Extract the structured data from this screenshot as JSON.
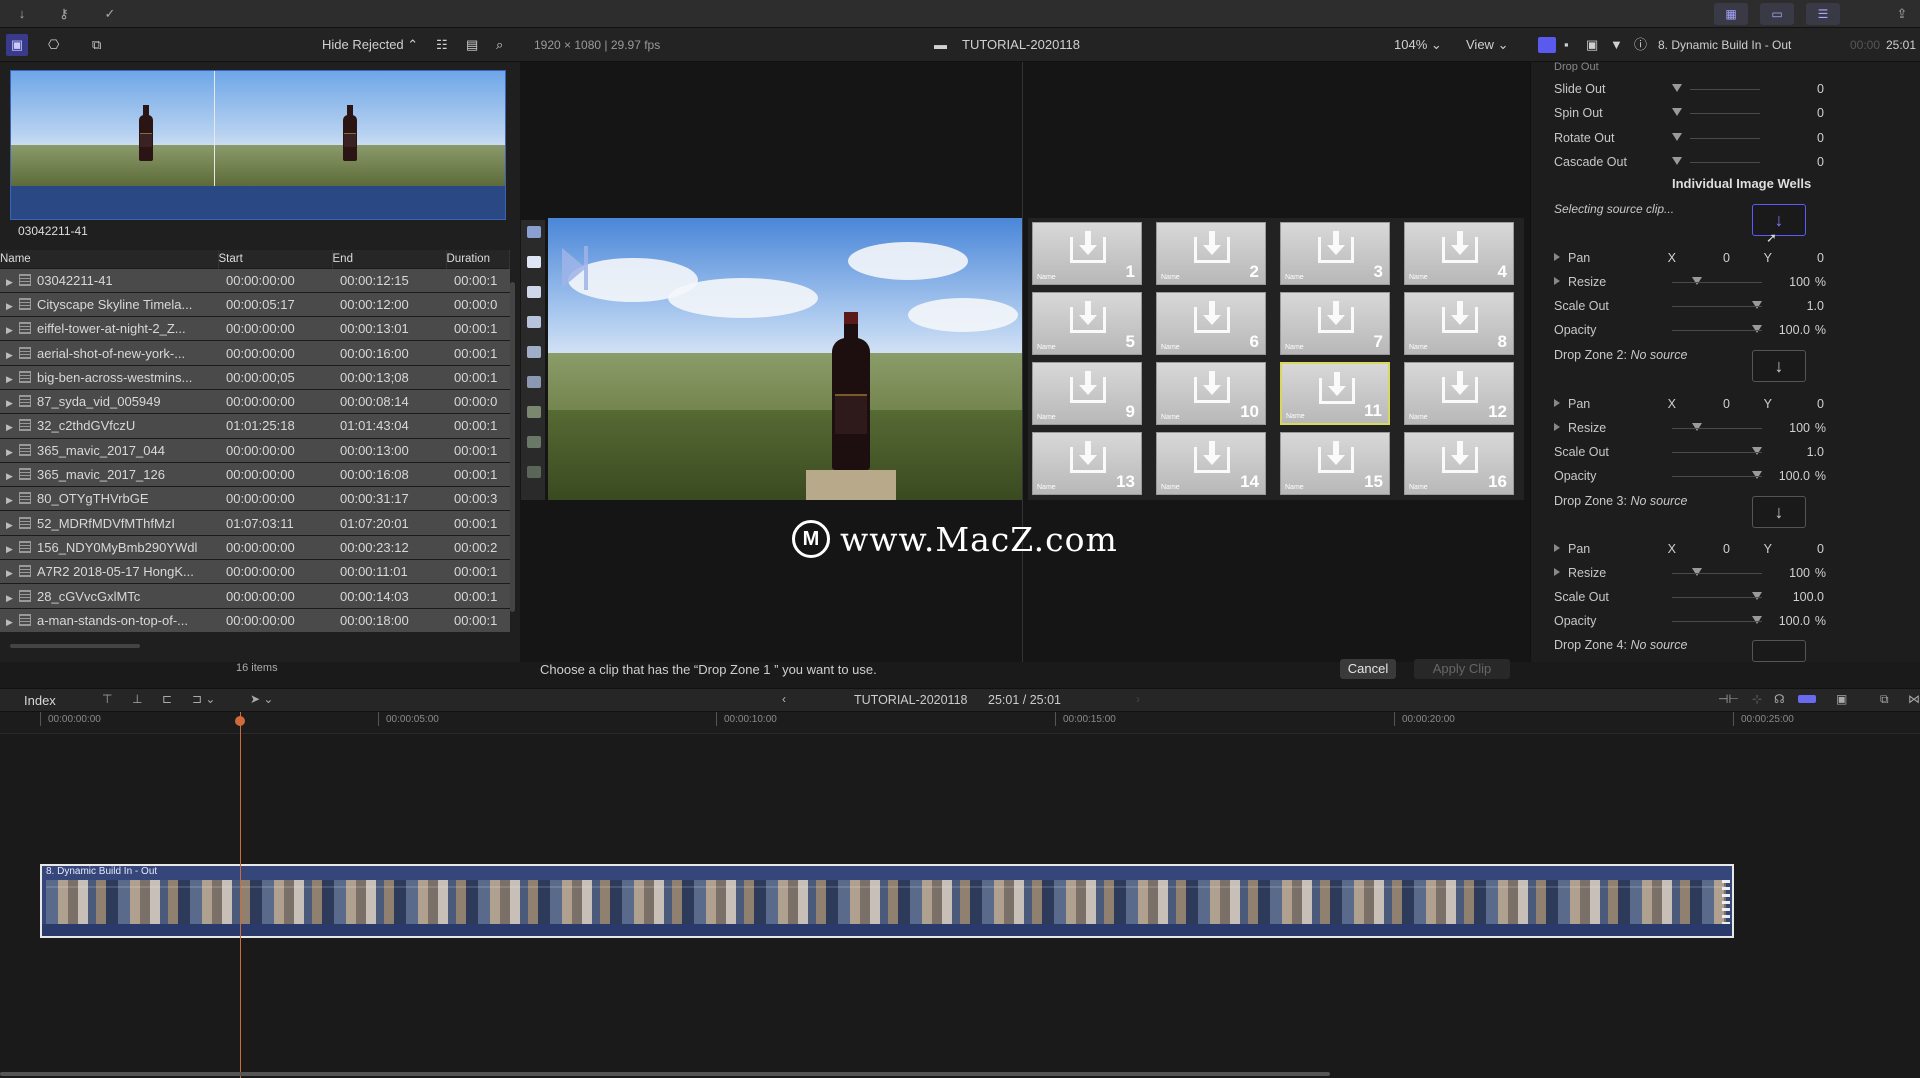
{
  "toolbar": {
    "import_icon": "download-icon",
    "keyword_icon": "key-icon",
    "check_icon": "checkmark-circle-icon"
  },
  "browser_bar": {
    "filter": "Hide Rejected",
    "format": "1920 × 1080 | 29.97 fps",
    "project_title": "TUTORIAL-2020118",
    "zoom": "104%",
    "view": "View",
    "clip_title": "8. Dynamic Build In - Out",
    "tc_dim": "00:00",
    "tc": "25:01"
  },
  "browser": {
    "thumbnail_label": "03042211-41",
    "columns": [
      "Name",
      "Start",
      "End",
      "Duration"
    ],
    "rows": [
      {
        "name": "03042211-41",
        "start": "00:00:00:00",
        "end": "00:00:12:15",
        "dur": "00:00:1"
      },
      {
        "name": "Cityscape Skyline Timela...",
        "start": "00:00:05:17",
        "end": "00:00:12:00",
        "dur": "00:00:0"
      },
      {
        "name": "eiffel-tower-at-night-2_Z...",
        "start": "00:00:00:00",
        "end": "00:00:13:01",
        "dur": "00:00:1"
      },
      {
        "name": "aerial-shot-of-new-york-...",
        "start": "00:00:00:00",
        "end": "00:00:16:00",
        "dur": "00:00:1"
      },
      {
        "name": "big-ben-across-westmins...",
        "start": "00:00:00;05",
        "end": "00:00:13;08",
        "dur": "00:00:1"
      },
      {
        "name": "87_syda_vid_005949",
        "start": "00:00:00:00",
        "end": "00:00:08:14",
        "dur": "00:00:0"
      },
      {
        "name": "32_c2thdGVfczU",
        "start": "01:01:25:18",
        "end": "01:01:43:04",
        "dur": "00:00:1"
      },
      {
        "name": "365_mavic_2017_044",
        "start": "00:00:00:00",
        "end": "00:00:13:00",
        "dur": "00:00:1"
      },
      {
        "name": "365_mavic_2017_126",
        "start": "00:00:00:00",
        "end": "00:00:16:08",
        "dur": "00:00:1"
      },
      {
        "name": "80_OTYgTHVrbGE",
        "start": "00:00:00:00",
        "end": "00:00:31:17",
        "dur": "00:00:3"
      },
      {
        "name": "52_MDRfMDVfMThfMzI",
        "start": "01:07:03:11",
        "end": "01:07:20:01",
        "dur": "00:00:1"
      },
      {
        "name": "156_NDY0MyBmb290YWdl",
        "start": "00:00:00:00",
        "end": "00:00:23:12",
        "dur": "00:00:2"
      },
      {
        "name": "A7R2 2018-05-17 HongK...",
        "start": "00:00:00:00",
        "end": "00:00:11:01",
        "dur": "00:00:1"
      },
      {
        "name": "28_cGVvcGxlMTc",
        "start": "00:00:00:00",
        "end": "00:00:14:03",
        "dur": "00:00:1"
      },
      {
        "name": "a-man-stands-on-top-of-...",
        "start": "00:00:00:00",
        "end": "00:00:18:00",
        "dur": "00:00:1"
      }
    ],
    "items_count": "16 items"
  },
  "viewer": {
    "tiles": [
      "1",
      "2",
      "3",
      "4",
      "5",
      "6",
      "7",
      "8",
      "9",
      "10",
      "11",
      "12",
      "13",
      "14",
      "15",
      "16"
    ],
    "tile_name": "Name",
    "selected_tile": 11,
    "watermark": "www.MacZ.com",
    "watermark_logo": "M",
    "instruction": "Choose a clip that has the “Drop Zone 1 ” you want to use.",
    "cancel": "Cancel",
    "apply": "Apply Clip"
  },
  "inspector": {
    "top_partial": "Drop Out",
    "rows_out": [
      {
        "label": "Slide Out",
        "value": "0"
      },
      {
        "label": "Spin Out",
        "value": "0"
      },
      {
        "label": "Rotate Out",
        "value": "0"
      },
      {
        "label": "Cascade Out",
        "value": "0"
      }
    ],
    "section": "Individual Image Wells",
    "selecting": "Selecting source clip...",
    "group1": {
      "pan_label": "Pan",
      "x_label": "X",
      "x": "0",
      "y_label": "Y",
      "y": "0",
      "resize_label": "Resize",
      "resize": "100",
      "unit_pct": "%",
      "scale_label": "Scale Out",
      "scale": "1.0",
      "opacity_label": "Opacity",
      "opacity": "100.0"
    },
    "dz2_label": "Drop Zone 2:",
    "dz2_value": "No source",
    "group2": {
      "pan_label": "Pan",
      "x_label": "X",
      "x": "0",
      "y_label": "Y",
      "y": "0",
      "resize_label": "Resize",
      "resize": "100",
      "unit_pct": "%",
      "scale_label": "Scale Out",
      "scale": "1.0",
      "opacity_label": "Opacity",
      "opacity": "100.0"
    },
    "dz3_label": "Drop Zone 3:",
    "dz3_value": "No source",
    "group3": {
      "pan_label": "Pan",
      "x_label": "X",
      "x": "0",
      "y_label": "Y",
      "y": "0",
      "resize_label": "Resize",
      "resize": "100",
      "unit_pct": "%",
      "scale_label": "Scale Out",
      "scale": "100.0",
      "opacity_label": "Opacity",
      "opacity": "100.0"
    },
    "dz4_label": "Drop Zone 4:",
    "dz4_value": "No source"
  },
  "timeline": {
    "index_label": "Index",
    "project": "TUTORIAL-2020118",
    "timecode": "25:01 / 25:01",
    "ruler": [
      "00:00:00:00",
      "00:00:05:00",
      "00:00:10:00",
      "00:00:15:00",
      "00:00:20:00",
      "00:00:25:00"
    ],
    "clip_title": "8. Dynamic Build In - Out"
  },
  "colors": {
    "accent": "#7a7aff",
    "selection_border": "#3d63b8",
    "playhead": "#d06a3a",
    "selected_tile": "#d8d860"
  }
}
